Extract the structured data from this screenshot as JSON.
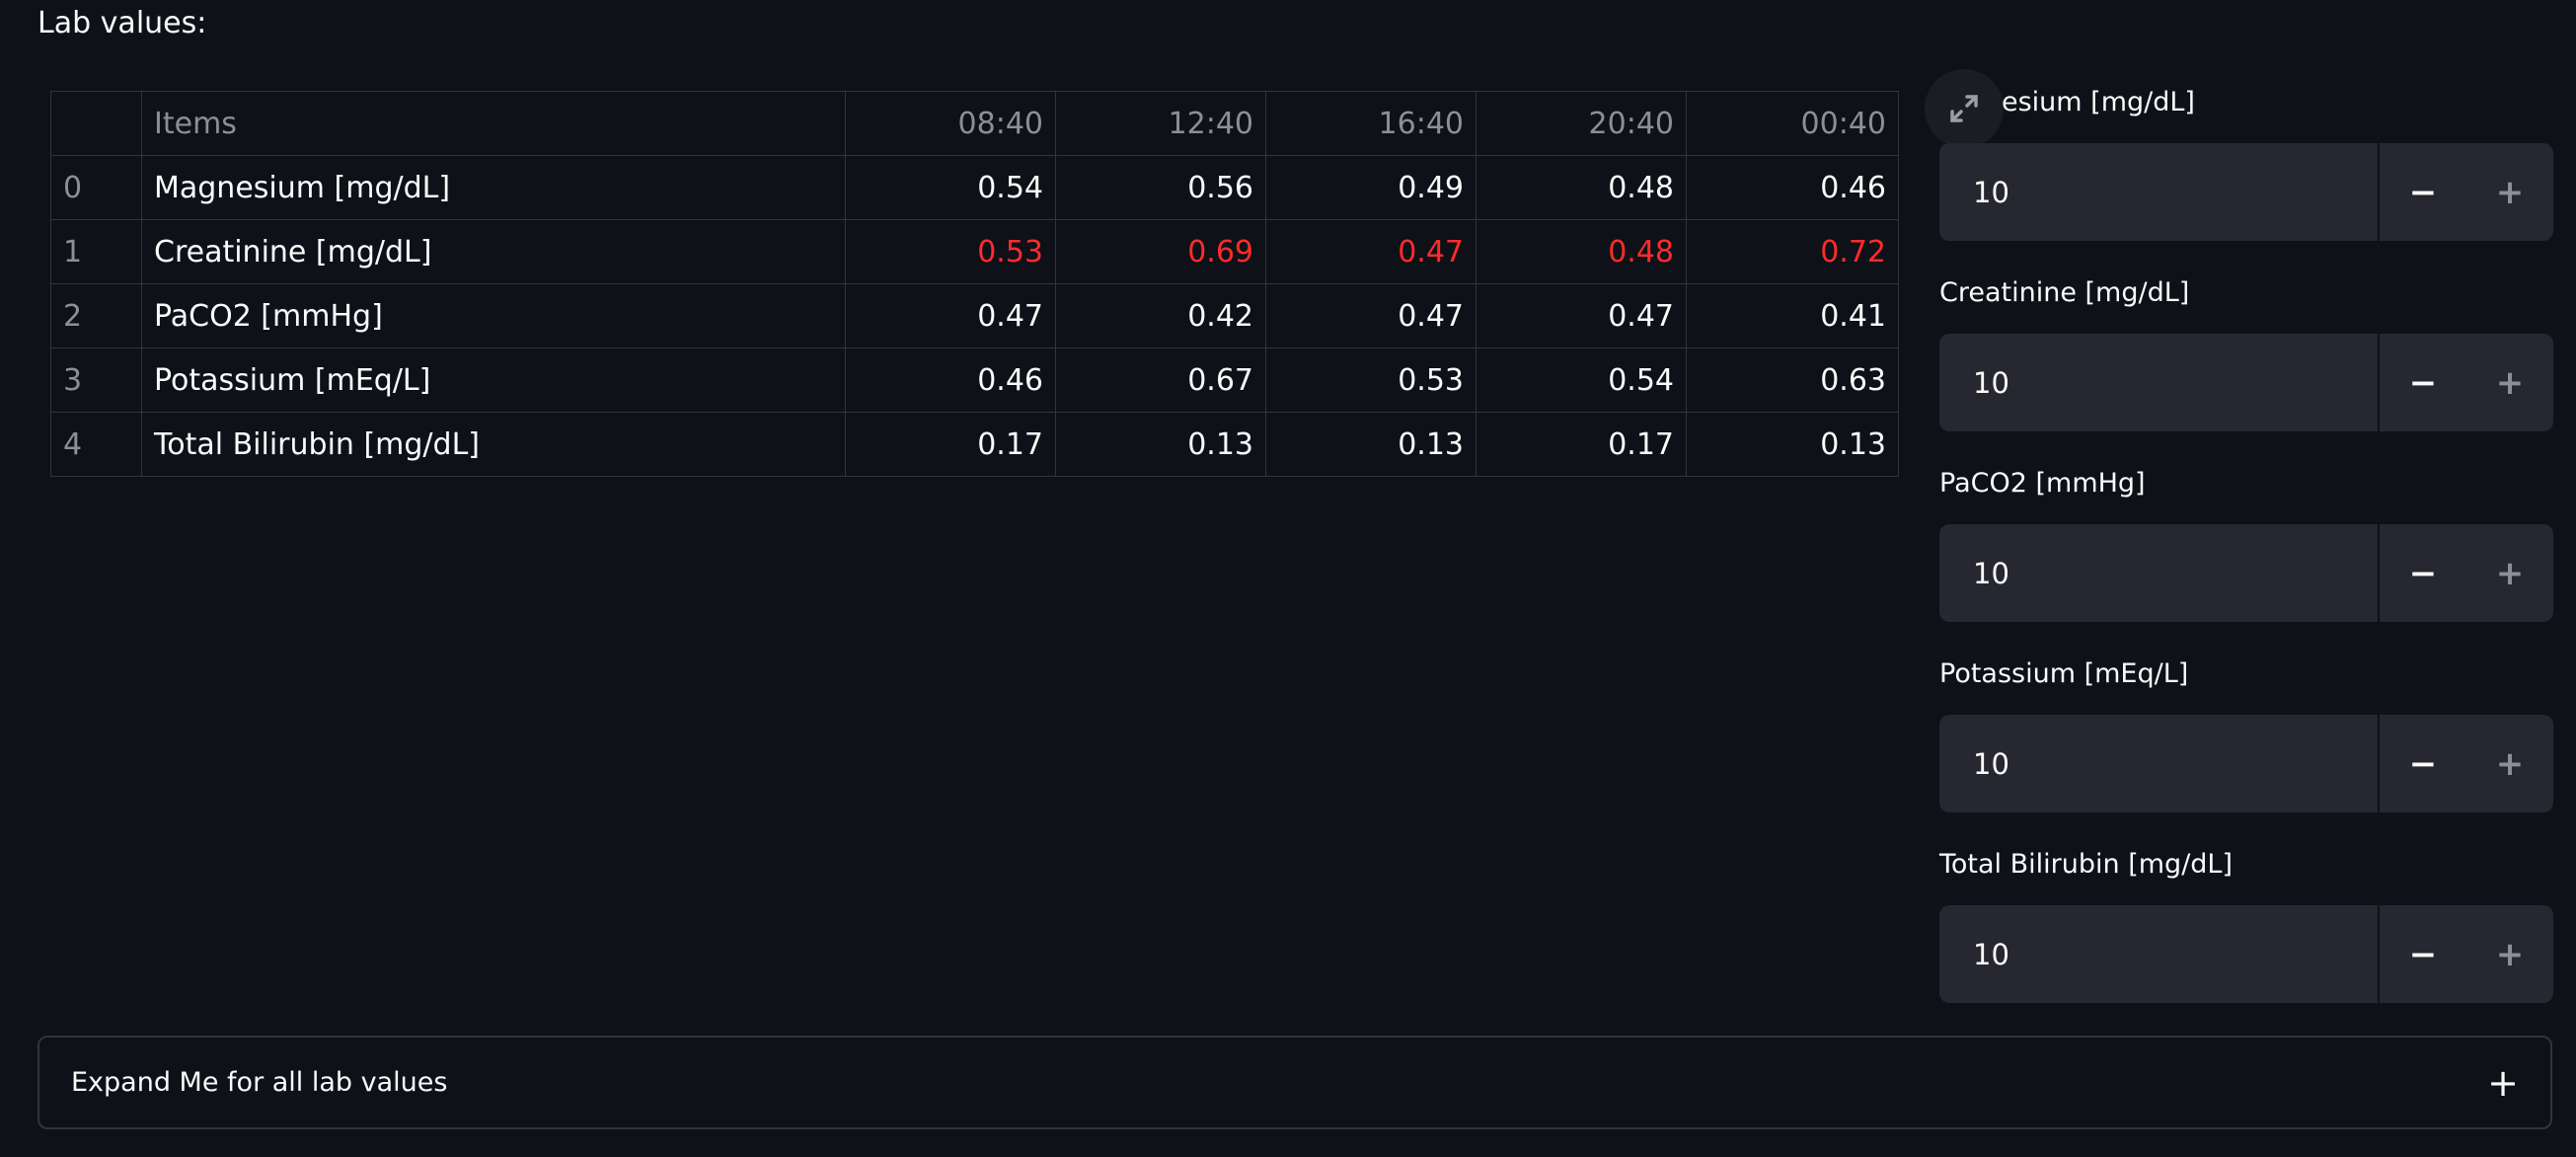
{
  "section_label": "Lab values:",
  "table": {
    "columns": [
      "",
      "Items",
      "08:40",
      "12:40",
      "16:40",
      "20:40",
      "00:40"
    ],
    "rows": [
      {
        "index": "0",
        "item": "Magnesium [mg/dL]",
        "values": [
          "0.54",
          "0.56",
          "0.49",
          "0.48",
          "0.46"
        ],
        "alert": false
      },
      {
        "index": "1",
        "item": "Creatinine [mg/dL]",
        "values": [
          "0.53",
          "0.69",
          "0.47",
          "0.48",
          "0.72"
        ],
        "alert": true
      },
      {
        "index": "2",
        "item": "PaCO2 [mmHg]",
        "values": [
          "0.47",
          "0.42",
          "0.47",
          "0.47",
          "0.41"
        ],
        "alert": false
      },
      {
        "index": "3",
        "item": "Potassium [mEq/L]",
        "values": [
          "0.46",
          "0.67",
          "0.53",
          "0.54",
          "0.63"
        ],
        "alert": false
      },
      {
        "index": "4",
        "item": "Total Bilirubin [mg/dL]",
        "values": [
          "0.17",
          "0.13",
          "0.13",
          "0.17",
          "0.13"
        ],
        "alert": false
      }
    ]
  },
  "inputs": [
    {
      "label": "esium [mg/dL]",
      "value": "10"
    },
    {
      "label": "Creatinine [mg/dL]",
      "value": "10"
    },
    {
      "label": "PaCO2 [mmHg]",
      "value": "10"
    },
    {
      "label": "Potassium [mEq/L]",
      "value": "10"
    },
    {
      "label": "Total Bilirubin [mg/dL]",
      "value": "10"
    }
  ],
  "stepper_minus": "−",
  "stepper_plus": "+",
  "expander": {
    "title": "Expand Me for all lab values",
    "icon": "+"
  },
  "icons": {
    "fullscreen": "fullscreen-expand-icon"
  },
  "colors": {
    "background": "#0e1117",
    "alert": "#ff2b2b",
    "input_bg": "#262730",
    "border": "#31343c"
  }
}
